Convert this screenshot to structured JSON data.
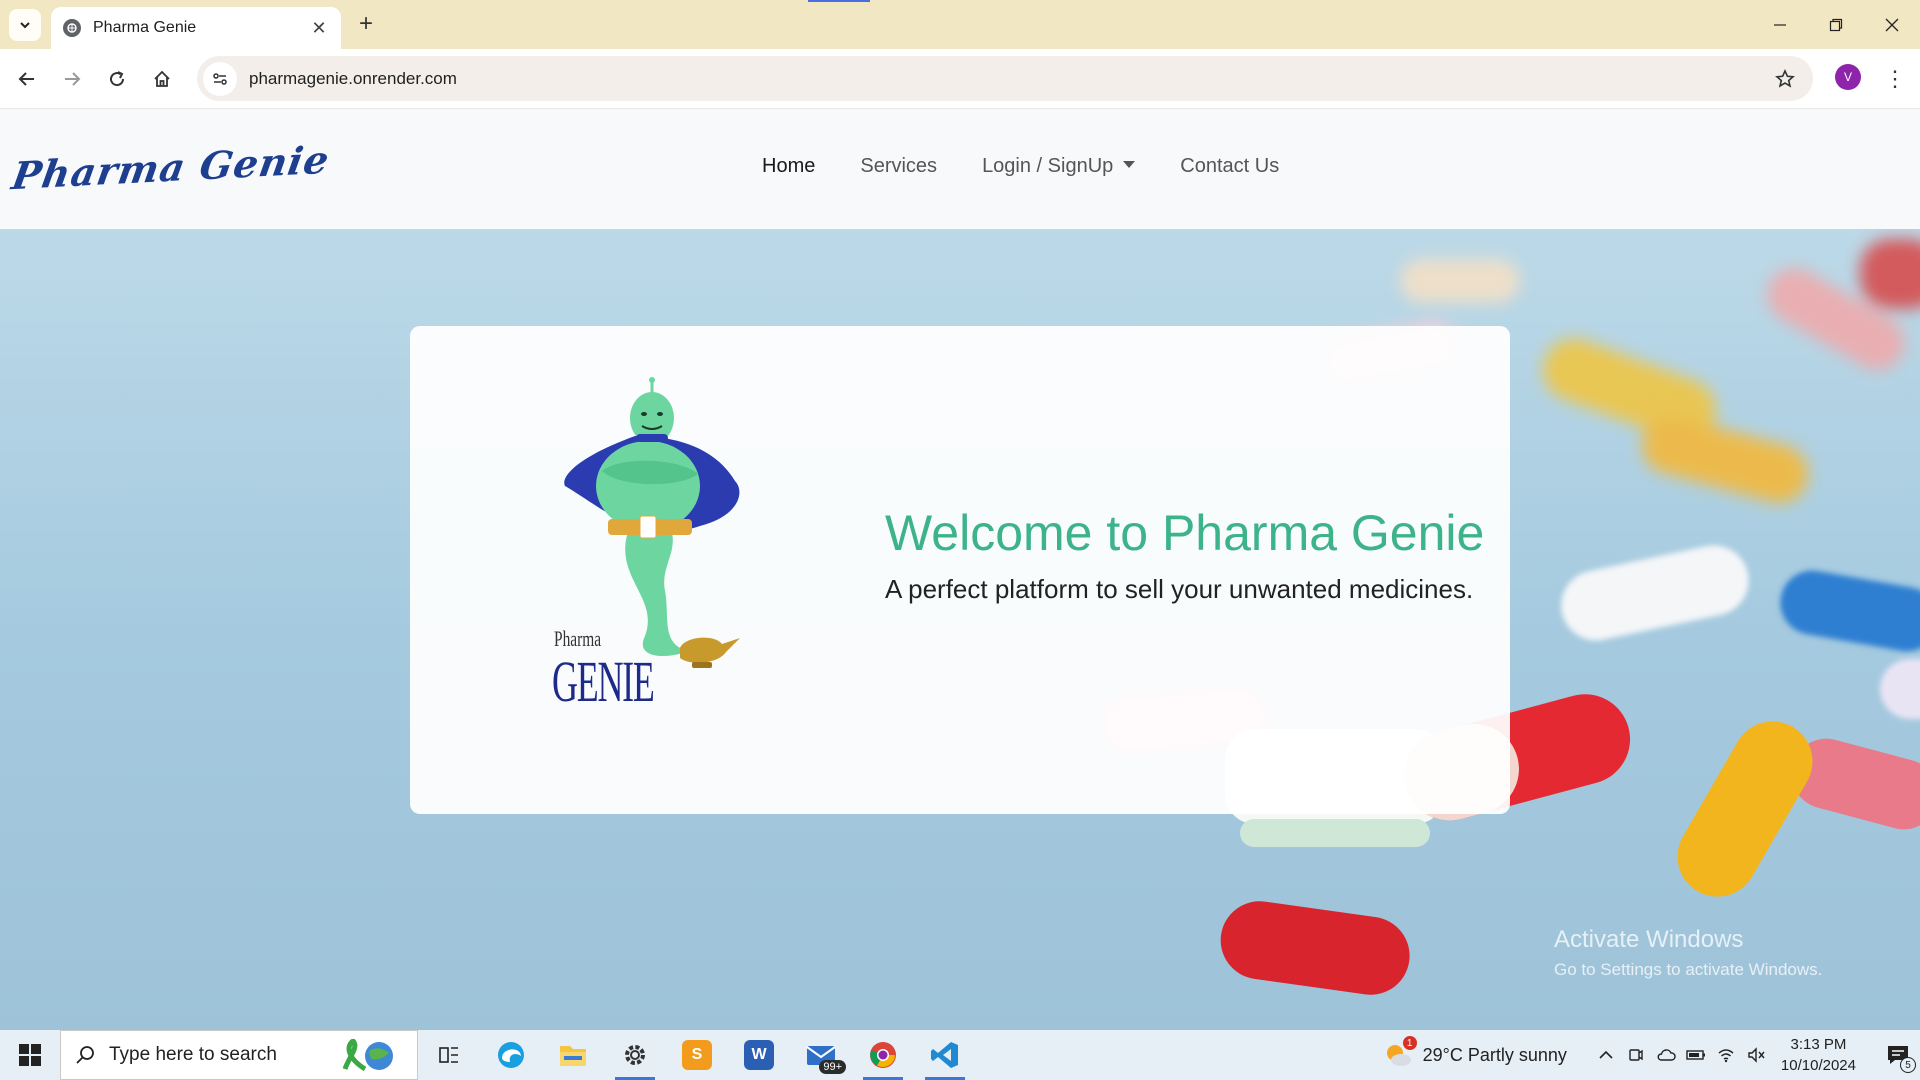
{
  "browser": {
    "tab_title": "Pharma Genie",
    "url": "pharmagenie.onrender.com",
    "profile_initial": "V",
    "new_tab_label": "+",
    "close_tab_label": "✕"
  },
  "site": {
    "logo_text": "Pharma Genie",
    "nav": {
      "home": "Home",
      "services": "Services",
      "login": "Login / SignUp",
      "contact": "Contact Us"
    },
    "hero": {
      "genie_label_top": "Pharma",
      "genie_label_bottom": "GENIE",
      "welcome": "Welcome to Pharma Genie",
      "tagline": "A perfect platform to sell your unwanted medicines."
    },
    "watermark": {
      "title": "Activate Windows",
      "subtitle": "Go to Settings to activate Windows."
    }
  },
  "taskbar": {
    "search_placeholder": "Type here to search",
    "mail_badge": "99+",
    "weather": "29°C  Partly sunny",
    "weather_alert": "1",
    "time": "3:13 PM",
    "date": "10/10/2024",
    "notification_count": "5"
  },
  "colors": {
    "accent": "#3db38a",
    "logo": "#1e3f8f",
    "tabbar": "#f2e7c3"
  }
}
